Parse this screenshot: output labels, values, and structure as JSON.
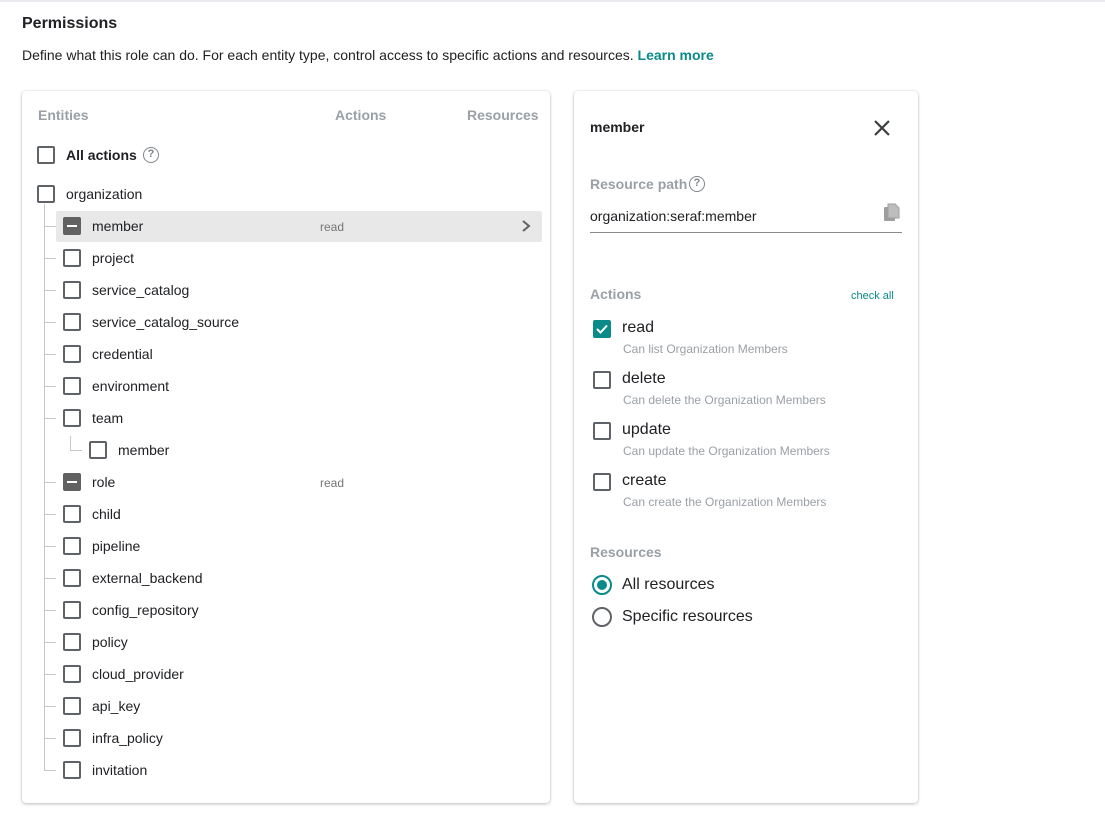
{
  "header": {
    "title": "Permissions",
    "description": "Define what this role can do. For each entity type, control access to specific actions and resources.",
    "learn_more": "Learn more"
  },
  "entities_panel": {
    "col_entities": "Entities",
    "col_actions": "Actions",
    "col_resources": "Resources",
    "all_actions": {
      "label": "All actions",
      "checked": false
    },
    "root": {
      "label": "organization",
      "checked": false
    },
    "children": [
      {
        "label": "member",
        "state": "indeterminate",
        "actions": "read",
        "selected": true
      },
      {
        "label": "project",
        "state": "unchecked"
      },
      {
        "label": "service_catalog",
        "state": "unchecked"
      },
      {
        "label": "service_catalog_source",
        "state": "unchecked"
      },
      {
        "label": "credential",
        "state": "unchecked"
      },
      {
        "label": "environment",
        "state": "unchecked"
      },
      {
        "label": "team",
        "state": "unchecked"
      },
      {
        "label": "member",
        "state": "unchecked",
        "nested_under": "team"
      },
      {
        "label": "role",
        "state": "indeterminate",
        "actions": "read"
      },
      {
        "label": "child",
        "state": "unchecked"
      },
      {
        "label": "pipeline",
        "state": "unchecked"
      },
      {
        "label": "external_backend",
        "state": "unchecked"
      },
      {
        "label": "config_repository",
        "state": "unchecked"
      },
      {
        "label": "policy",
        "state": "unchecked"
      },
      {
        "label": "cloud_provider",
        "state": "unchecked"
      },
      {
        "label": "api_key",
        "state": "unchecked"
      },
      {
        "label": "infra_policy",
        "state": "unchecked"
      },
      {
        "label": "invitation",
        "state": "unchecked"
      }
    ]
  },
  "detail_panel": {
    "title": "member",
    "resource_path_label": "Resource path",
    "resource_path_value": "organization:seraf:member",
    "actions_label": "Actions",
    "check_all": "check all",
    "actions": [
      {
        "name": "read",
        "description": "Can list Organization Members",
        "checked": true
      },
      {
        "name": "delete",
        "description": "Can delete the Organization Members",
        "checked": false
      },
      {
        "name": "update",
        "description": "Can update the Organization Members",
        "checked": false
      },
      {
        "name": "create",
        "description": "Can create the Organization Members",
        "checked": false
      }
    ],
    "resources_label": "Resources",
    "resources": [
      {
        "label": "All resources",
        "selected": true
      },
      {
        "label": "Specific resources",
        "selected": false
      }
    ]
  },
  "colors": {
    "accent": "#0b8a8a",
    "selected_row": "#e8e8e8",
    "muted_text": "#9aa0a6"
  },
  "icons": {
    "help": "help-circle-icon",
    "close": "close-icon",
    "copy": "copy-icon",
    "chevron": "chevron-right-icon"
  }
}
